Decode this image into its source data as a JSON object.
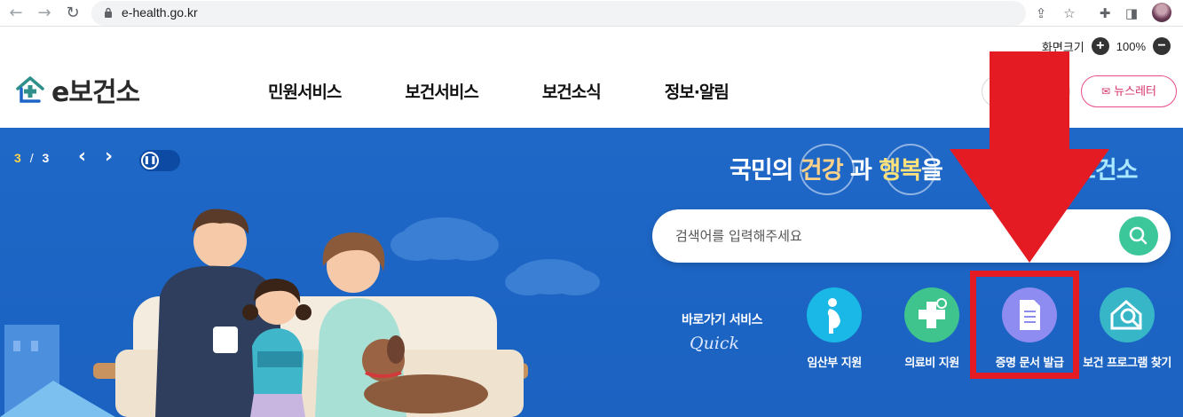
{
  "browser": {
    "url": "e-health.go.kr",
    "back_icon": "arrow-left-icon",
    "forward_icon": "arrow-right-icon",
    "reload_icon": "reload-icon"
  },
  "header": {
    "zoom_label": "화면크기",
    "zoom_value": "100%",
    "zoom_in": "+",
    "zoom_out": "−",
    "logo_text": "e보건소",
    "nav": [
      "민원서비스",
      "보건서비스",
      "보건소식",
      "정보·알림"
    ],
    "newsletter_label": "뉴스레터"
  },
  "hero": {
    "slide_current": "3",
    "slide_separator": "/",
    "slide_total": "3",
    "slogan": {
      "part1": "국민의 ",
      "highlight1": "건강",
      "part2": " 과 ",
      "highlight2": "행복",
      "part3": "을",
      "brand": "보건소"
    },
    "search_placeholder": "검색어를 입력해주세요",
    "quick_title": "바로가기 서비스",
    "quick_sub": "Quick",
    "quick_items": [
      {
        "label": "임산부 지원",
        "icon": "pregnant-woman-icon",
        "color": "#1ab8e6"
      },
      {
        "label": "의료비 지원",
        "icon": "medical-cross-icon",
        "color": "#3ec48c"
      },
      {
        "label": "증명 문서 발급",
        "icon": "document-icon",
        "color": "#8e8cf0"
      },
      {
        "label": "보건 프로그램 찾기",
        "icon": "search-house-icon",
        "color": "#36b6c6"
      }
    ]
  },
  "colors": {
    "hero_bg": "#1f68c7",
    "highlight_box": "#e51b24",
    "newsletter_pink": "#d6336c"
  }
}
